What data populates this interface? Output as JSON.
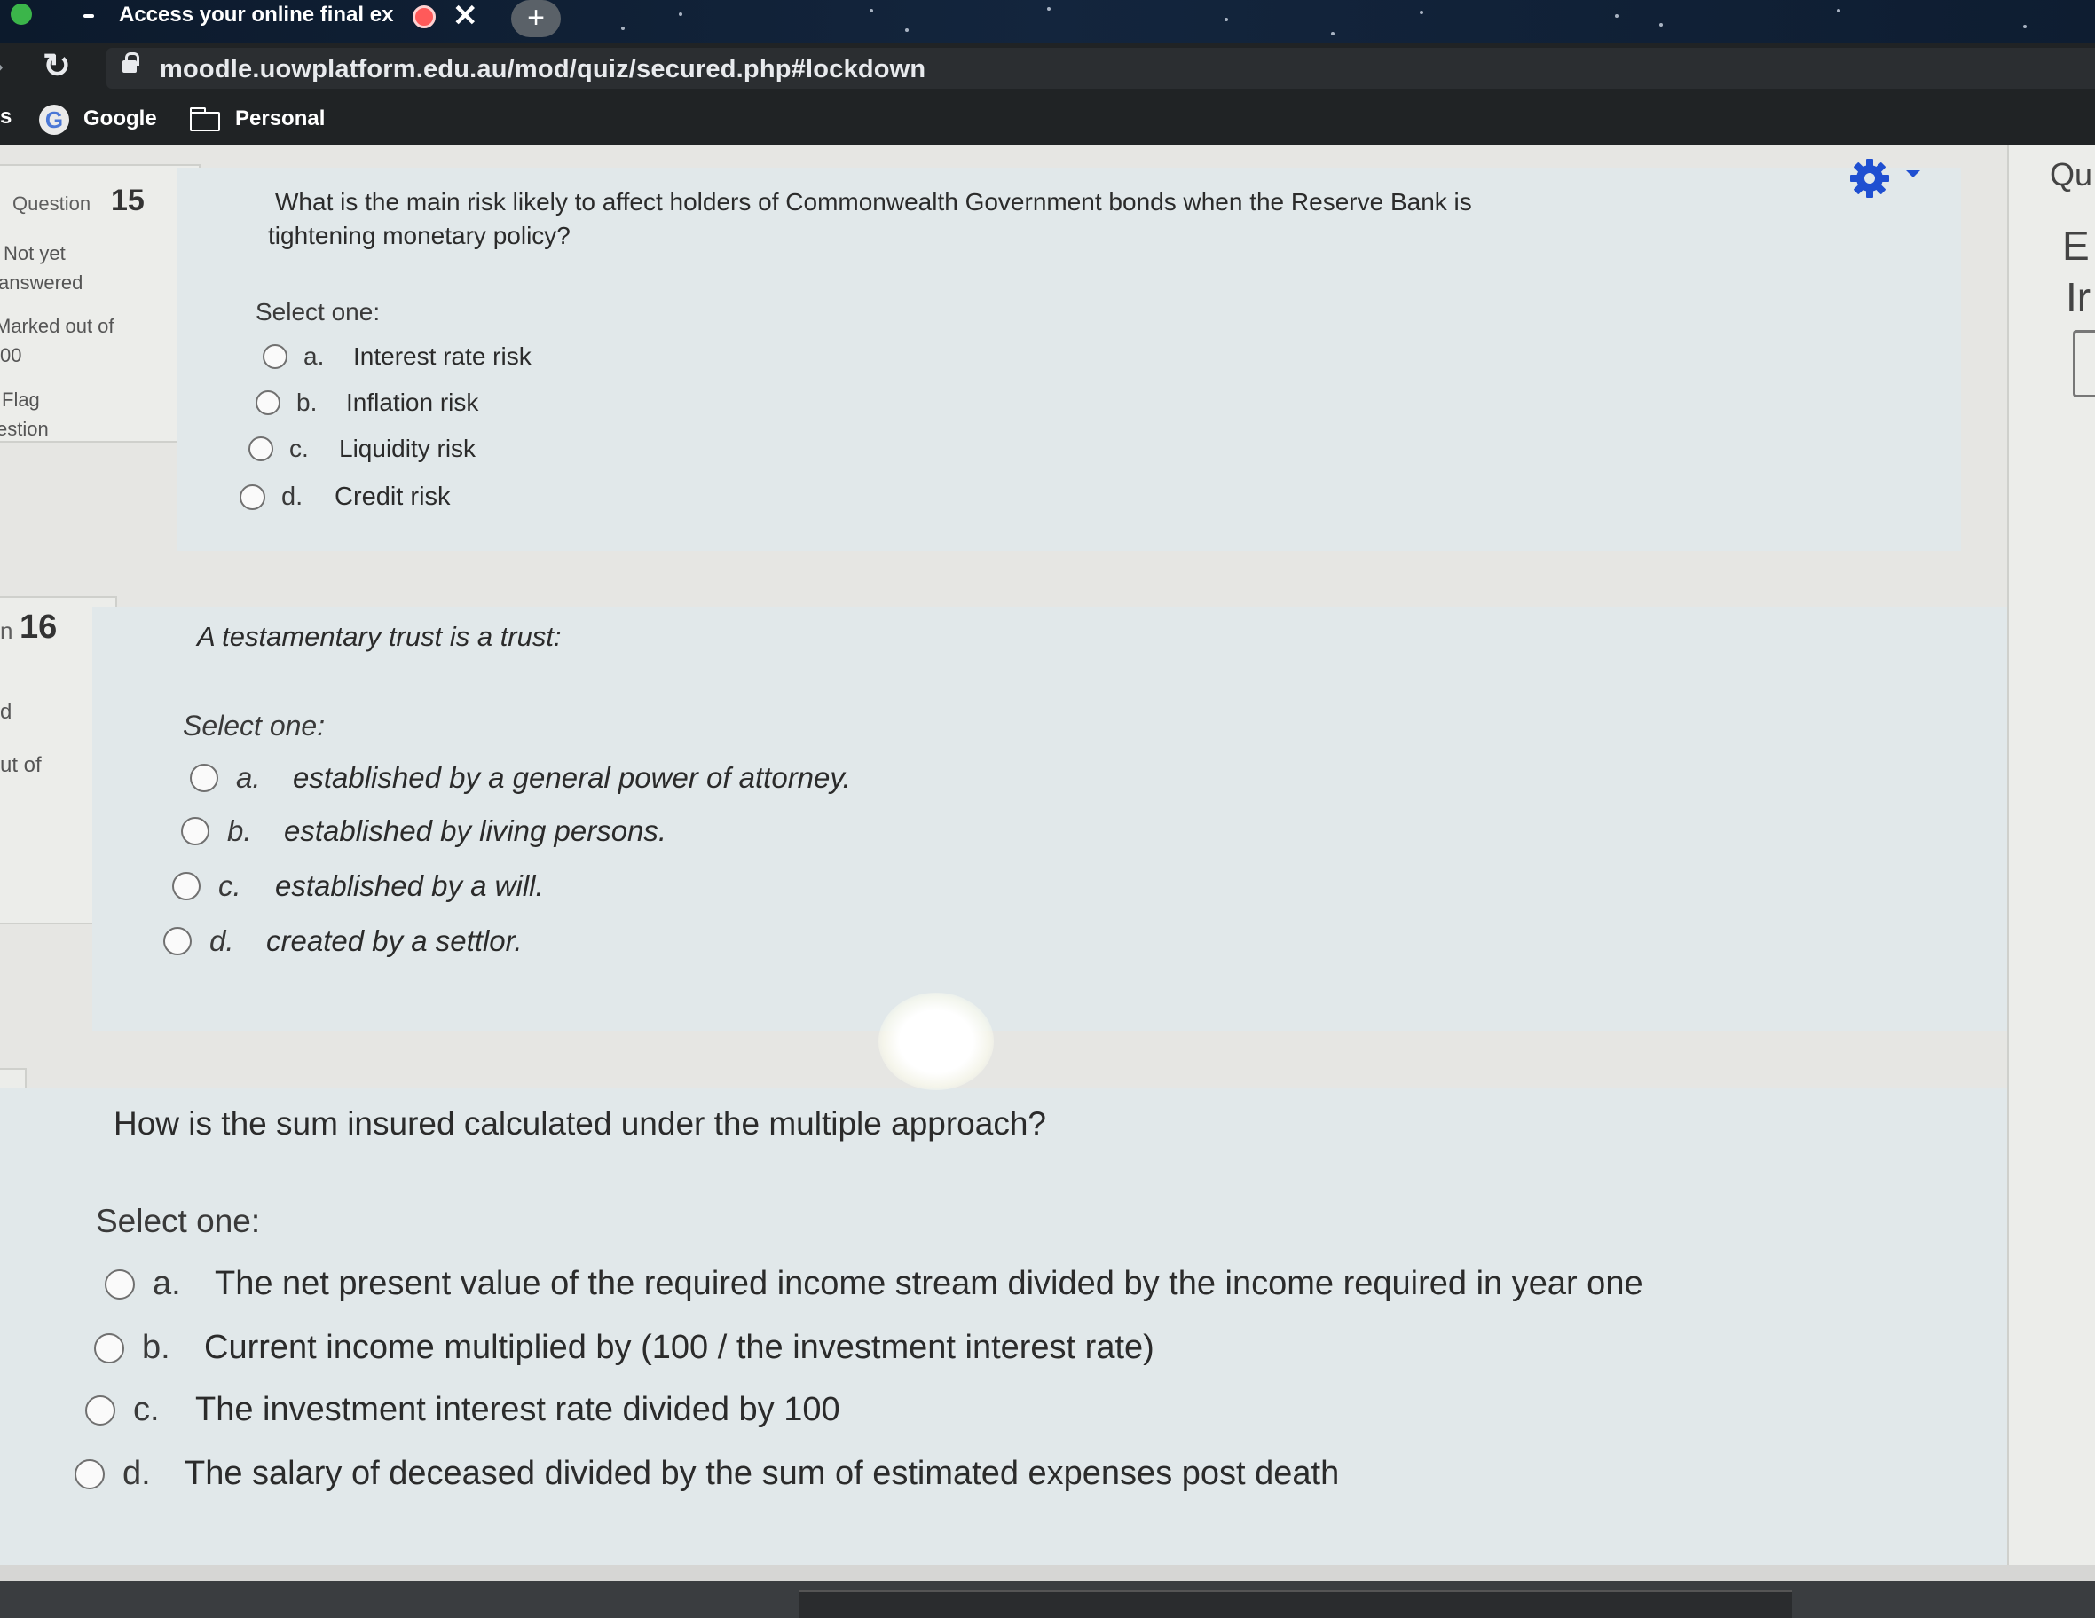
{
  "browser": {
    "tab_title": "Access your online final ex",
    "url": "moodle.uowplatform.edu.au/mod/quiz/secured.php#lockdown",
    "new_tab_label": "+",
    "close_label": "✕",
    "reload_icon": "↻",
    "bookmarks": {
      "edge_label": "s",
      "google_letter": "G",
      "google": "Google",
      "personal": "Personal"
    }
  },
  "questions": [
    {
      "info": {
        "label": "Question",
        "number": "15",
        "status_line1": "Not yet",
        "status_line2": "answered",
        "marked_line1": "Marked out of",
        "marked_line2": "00",
        "flag_line1": "Flag",
        "flag_line2": "estion"
      },
      "text_line1": "What is the main risk likely to affect holders of Commonwealth Government bonds when the Reserve Bank is",
      "text_line2": "tightening monetary policy?",
      "select_label": "Select one:",
      "options": [
        {
          "letter": "a.",
          "text": "Interest rate risk"
        },
        {
          "letter": "b.",
          "text": "Inflation risk"
        },
        {
          "letter": "c.",
          "text": "Liquidity risk"
        },
        {
          "letter": "d.",
          "text": "Credit risk"
        }
      ]
    },
    {
      "info": {
        "label": "n",
        "number": "16",
        "status_line": "d",
        "marked_line": "ut of"
      },
      "text": "A testamentary trust is a trust:",
      "select_label": "Select one:",
      "options": [
        {
          "letter": "a.",
          "text": "established by a general power of attorney."
        },
        {
          "letter": "b.",
          "text": "established by living persons."
        },
        {
          "letter": "c.",
          "text": "established by a will."
        },
        {
          "letter": "d.",
          "text": "created by a settlor."
        }
      ]
    },
    {
      "text": "How is the sum insured calculated under the multiple approach?",
      "select_label": "Select one:",
      "options": [
        {
          "letter": "a.",
          "text": "The net present value of the required income stream divided by the income required in year one"
        },
        {
          "letter": "b.",
          "text": "Current income multiplied by (100 / the investment interest rate)"
        },
        {
          "letter": "c.",
          "text": "The investment interest rate divided by 100"
        },
        {
          "letter": "d.",
          "text": "The salary of deceased divided by the sum of estimated expenses post death"
        }
      ]
    }
  ],
  "right_panel": {
    "title_fragment": "Qu",
    "line1": "E",
    "line2": "Ir"
  },
  "colors": {
    "gear": "#1f4fd1"
  }
}
